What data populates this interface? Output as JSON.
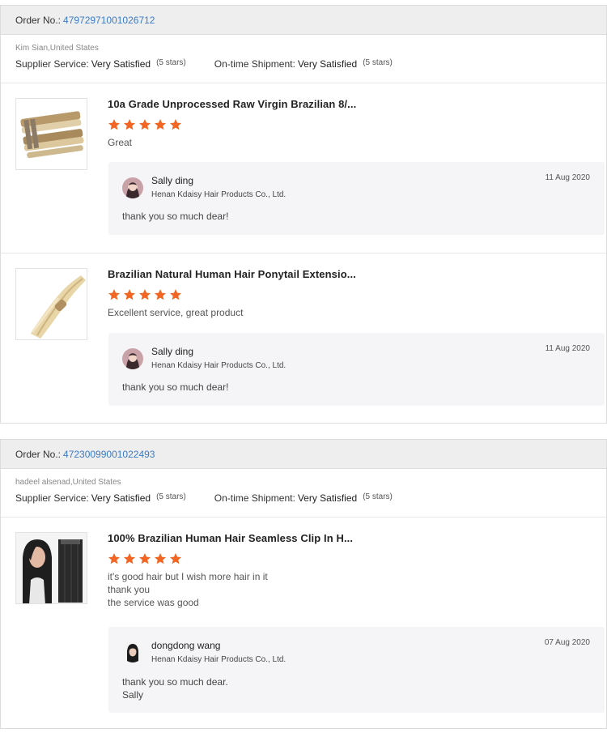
{
  "orders": [
    {
      "order_label": "Order No.:",
      "order_number": "47972971001026712",
      "buyer": "Kim Sian,United States",
      "supplier_label": "Supplier Service:",
      "supplier_value": "Very Satisfied",
      "supplier_stars": "(5 stars)",
      "shipment_label": "On-time Shipment:",
      "shipment_value": "Very Satisfied",
      "shipment_stars": "(5 stars)",
      "items": [
        {
          "title": "10a Grade Unprocessed Raw Virgin Brazilian 8/...",
          "rating": 5,
          "comment": "Great",
          "reply": {
            "name": "Sally ding",
            "company": "Henan Kdaisy Hair Products Co., Ltd.",
            "date": "11 Aug 2020",
            "text": "thank you so much dear!"
          }
        },
        {
          "title": "Brazilian Natural Human Hair Ponytail Extensio...",
          "rating": 5,
          "comment": "Excellent service, great product",
          "reply": {
            "name": "Sally ding",
            "company": "Henan Kdaisy Hair Products Co., Ltd.",
            "date": "11 Aug 2020",
            "text": "thank you so much dear!"
          }
        }
      ]
    },
    {
      "order_label": "Order No.:",
      "order_number": "47230099001022493",
      "buyer": "hadeel alsenad,United States",
      "supplier_label": "Supplier Service:",
      "supplier_value": "Very Satisfied",
      "supplier_stars": "(5 stars)",
      "shipment_label": "On-time Shipment:",
      "shipment_value": "Very Satisfied",
      "shipment_stars": "(5 stars)",
      "items": [
        {
          "title": "100% Brazilian Human Hair Seamless Clip In H...",
          "rating": 5,
          "comment_lines": [
            "it's good hair but I wish more hair in it",
            "thank you",
            "the service was good"
          ],
          "reply": {
            "name": "dongdong wang",
            "company": "Henan Kdaisy Hair Products Co., Ltd.",
            "date": "07 Aug 2020",
            "text_lines": [
              "thank you so much dear.",
              "Sally"
            ]
          }
        }
      ]
    }
  ],
  "colors": {
    "star": "#f26522",
    "link": "#3c7bc5",
    "header_bg": "#eeeeee",
    "reply_bg": "#f5f5f7"
  },
  "icons": {
    "star": "star-icon"
  }
}
